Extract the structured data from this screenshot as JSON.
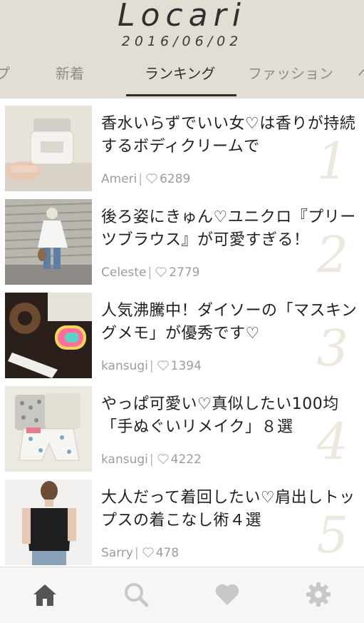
{
  "header": {
    "logo": "Locari",
    "date": "2016/06/02"
  },
  "tabs": [
    {
      "label": "プ",
      "active": false
    },
    {
      "label": "新着",
      "active": false
    },
    {
      "label": "ランキング",
      "active": true
    },
    {
      "label": "ファッション",
      "active": false
    },
    {
      "label": "ヘ",
      "active": false
    }
  ],
  "articles": [
    {
      "rank": "1",
      "title": "香水いらずでいい女♡は香りが持続するボディクリームで",
      "author": "Ameri",
      "likes": "6289",
      "thumb_icon": "body-cream-jar-photo"
    },
    {
      "rank": "2",
      "title": "後ろ姿にきゅん♡ユニクロ『プリーツブラウス』が可愛すぎる！",
      "author": "Celeste",
      "likes": "2779",
      "thumb_icon": "blouse-back-view-photo"
    },
    {
      "rank": "3",
      "title": "人気沸騰中！ダイソーの「マスキングメモ」が優秀です♡",
      "author": "kansugi",
      "likes": "1394",
      "thumb_icon": "masking-tape-photo"
    },
    {
      "rank": "4",
      "title": "やっぱ可愛い♡真似したい100均「手ぬぐいリメイク」８選",
      "author": "kansugi",
      "likes": "4222",
      "thumb_icon": "tenugui-shorts-photo"
    },
    {
      "rank": "5",
      "title": "大人だって着回したい♡肩出しトップスの着こなし術４選",
      "author": "Sarry",
      "likes": "478",
      "thumb_icon": "off-shoulder-top-photo"
    }
  ],
  "separator": "|",
  "bottom_nav": [
    {
      "name": "home",
      "icon": "home-icon",
      "active": true
    },
    {
      "name": "search",
      "icon": "search-icon",
      "active": false
    },
    {
      "name": "favorites",
      "icon": "heart-icon",
      "active": false
    },
    {
      "name": "settings",
      "icon": "gear-icon",
      "active": false
    }
  ],
  "colors": {
    "header_bg": "#e2ded6",
    "active_tab": "#2e2e2e",
    "inactive_tab": "#8f8c86",
    "rank_number": "#ede8dd",
    "meta_text": "#9c9c9c",
    "nav_active": "#555555",
    "nav_inactive": "#c8c8c8"
  }
}
